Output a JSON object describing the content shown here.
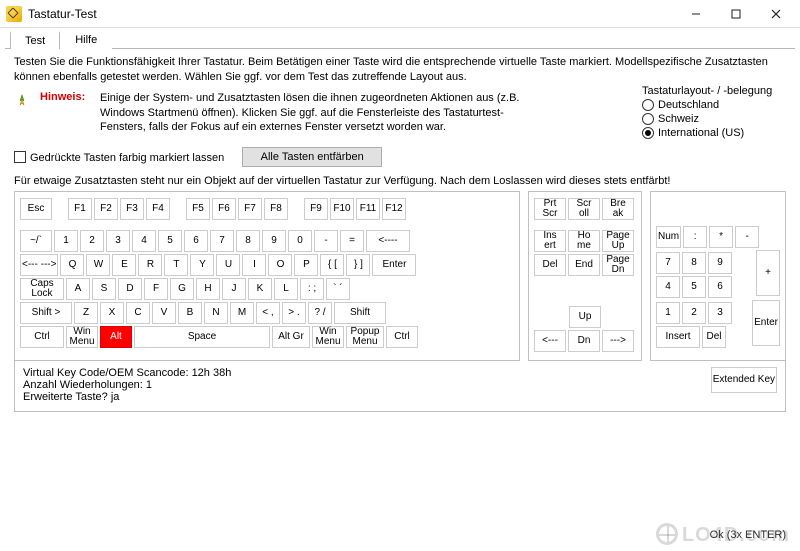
{
  "window": {
    "title": "Tastatur-Test"
  },
  "tabs": {
    "test": "Test",
    "help": "Hilfe"
  },
  "intro": "Testen Sie die Funktionsfähigkeit Ihrer Tastatur. Beim Betätigen einer Taste wird die entsprechende virtuelle Taste markiert. Modellspezifische Zusatztasten können ebenfalls getestet werden. Wählen Sie ggf. vor dem Test das zutreffende Layout aus.",
  "hint": {
    "label": "Hinweis:",
    "body": "Einige der System- und Zusatztasten lösen die ihnen zugeordneten Aktionen aus (z.B. Windows Startmenü öffnen). Klicken Sie ggf. auf die Fensterleiste des Tastaturtest-Fensters, falls der Fokus auf ein externes Fenster versetzt worden war."
  },
  "layout": {
    "title": "Tastaturlayout- / -belegung",
    "de": "Deutschland",
    "ch": "Schweiz",
    "us": "International (US)",
    "selected": "us"
  },
  "controls": {
    "checkbox": "Gedrückte Tasten farbig markiert lassen",
    "reset": "Alle Tasten entfärben"
  },
  "note": "Für etwaige Zusatztasten steht nur ein Objekt auf der virtuellen Tastatur zur Verfügung. Nach dem Loslassen wird dieses stets entfärbt!",
  "keys": {
    "esc": "Esc",
    "f1": "F1",
    "f2": "F2",
    "f3": "F3",
    "f4": "F4",
    "f5": "F5",
    "f6": "F6",
    "f7": "F7",
    "f8": "F8",
    "f9": "F9",
    "f10": "F10",
    "f11": "F11",
    "f12": "F12",
    "tilde": "~/`",
    "k1": "1",
    "k2": "2",
    "k3": "3",
    "k4": "4",
    "k5": "5",
    "k6": "6",
    "k7": "7",
    "k8": "8",
    "k9": "9",
    "k0": "0",
    "minus": "-",
    "eq": "=",
    "bksp": "<----",
    "tab": "<--- --->",
    "q": "Q",
    "w": "W",
    "e": "E",
    "r": "R",
    "t": "T",
    "y": "Y",
    "u": "U",
    "i": "I",
    "o": "O",
    "p": "P",
    "lbr": "{ [",
    "rbr": "} ]",
    "enter": "Enter",
    "caps": "Caps\nLock",
    "a": "A",
    "s": "S",
    "d": "D",
    "f": "F",
    "g": "G",
    "h": "H",
    "j": "J",
    "k": "K",
    "l": "L",
    "semi": ": ;",
    "quote": "` ´",
    "lshift": "Shift  >",
    "z": "Z",
    "x": "X",
    "c": "C",
    "v": "V",
    "b": "B",
    "n": "N",
    "m": "M",
    "comma": "< ,",
    "dot": "> .",
    "slash": "? /",
    "rshift": "Shift",
    "lctrl": "Ctrl",
    "lwin": "Win\nMenu",
    "lalt": "Alt",
    "space": "Space",
    "altgr": "Alt Gr",
    "rwin": "Win\nMenu",
    "popup": "Popup\nMenu",
    "rctrl": "Ctrl",
    "prtscr": "Prt\nScr",
    "scroll": "Scr\noll",
    "break": "Bre\nak",
    "ins": "Ins\nert",
    "home": "Ho\nme",
    "pgup": "Page\nUp",
    "del": "Del",
    "end": "End",
    "pgdn": "Page\nDn",
    "up": "Up",
    "left": "<---",
    "down": "Dn",
    "right": "--->",
    "num": "Num",
    "div": ":",
    "mul": "*",
    "sub": "-",
    "n7": "7",
    "n8": "8",
    "n9": "9",
    "add": "+",
    "n4": "4",
    "n5": "5",
    "n6": "6",
    "n1": "1",
    "n2": "2",
    "n3": "3",
    "nenter": "Enter",
    "n0": "Insert",
    "ndel": "Del"
  },
  "status": {
    "vkcode_label": "Virtual Key Code/OEM Scancode:",
    "vkcode_value": "12h 38h",
    "repeat_label": "Anzahl Wiederholungen:",
    "repeat_value": "1",
    "ext_label": "Erweiterte Taste?",
    "ext_value": "ja",
    "ext_key": "Extended Key"
  },
  "footer": {
    "ok": "Ok (3x ENTER)"
  },
  "pressed_key": "lalt"
}
